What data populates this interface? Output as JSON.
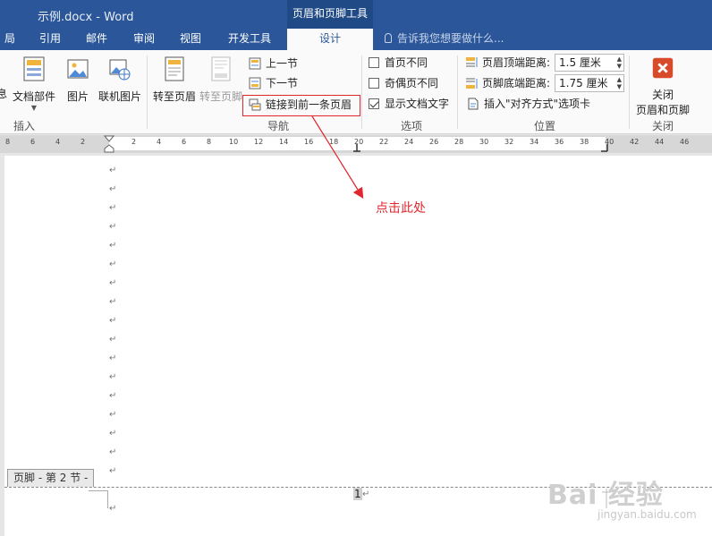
{
  "window": {
    "title": "示例.docx - Word",
    "context_group": "页眉和页脚工具"
  },
  "tabs": [
    {
      "label": "局",
      "active": false
    },
    {
      "label": "引用",
      "active": false
    },
    {
      "label": "邮件",
      "active": false
    },
    {
      "label": "审阅",
      "active": false
    },
    {
      "label": "视图",
      "active": false
    },
    {
      "label": "开发工具",
      "active": false
    },
    {
      "label": "设计",
      "active": true
    }
  ],
  "tell_me": "告诉我您想要做什么...",
  "ribbon": {
    "insert": {
      "label": "插入",
      "info_partial": "息",
      "doc_parts": "文档部件",
      "picture": "图片",
      "online_picture": "联机图片"
    },
    "navigation": {
      "label": "导航",
      "goto_header": "转至页眉",
      "goto_footer": "转至页脚",
      "prev_section": "上一节",
      "next_section": "下一节",
      "link_to_previous": "链接到前一条页眉"
    },
    "options": {
      "label": "选项",
      "different_first": {
        "text": "首页不同",
        "checked": false
      },
      "different_odd_even": {
        "text": "奇偶页不同",
        "checked": false
      },
      "show_doc_text": {
        "text": "显示文档文字",
        "checked": true
      }
    },
    "position": {
      "label": "位置",
      "header_from_top": "页眉顶端距离:",
      "header_from_top_value": "1.5 厘米",
      "footer_from_bottom": "页脚底端距离:",
      "footer_from_bottom_value": "1.75 厘米",
      "insert_align_tab": "插入\"对齐方式\"选项卡"
    },
    "close": {
      "label": "关闭",
      "close_button": "关闭\n页眉和页脚",
      "close_line1": "关闭",
      "close_line2": "页眉和页脚"
    }
  },
  "ruler": {
    "left_ticks": [
      "8",
      "6",
      "4",
      "2"
    ],
    "right_ticks": [
      "2",
      "4",
      "6",
      "8",
      "10",
      "12",
      "14",
      "16",
      "18",
      "20",
      "22",
      "24",
      "26",
      "28",
      "30",
      "32",
      "34",
      "36",
      "38",
      "40",
      "42",
      "44",
      "46"
    ]
  },
  "document": {
    "paragraph_mark": "↵",
    "footer_tag": "页脚 - 第 2 节 -",
    "page_number": "1"
  },
  "annotation": {
    "text": "点击此处",
    "color": "#e0262e"
  },
  "watermark": {
    "text": "Bai 经验",
    "sub": "jingyan.baidu.com"
  },
  "colors": {
    "word_blue": "#2b579a",
    "ribbon_bg": "#fafafa",
    "highlight_red": "#e0262e"
  }
}
